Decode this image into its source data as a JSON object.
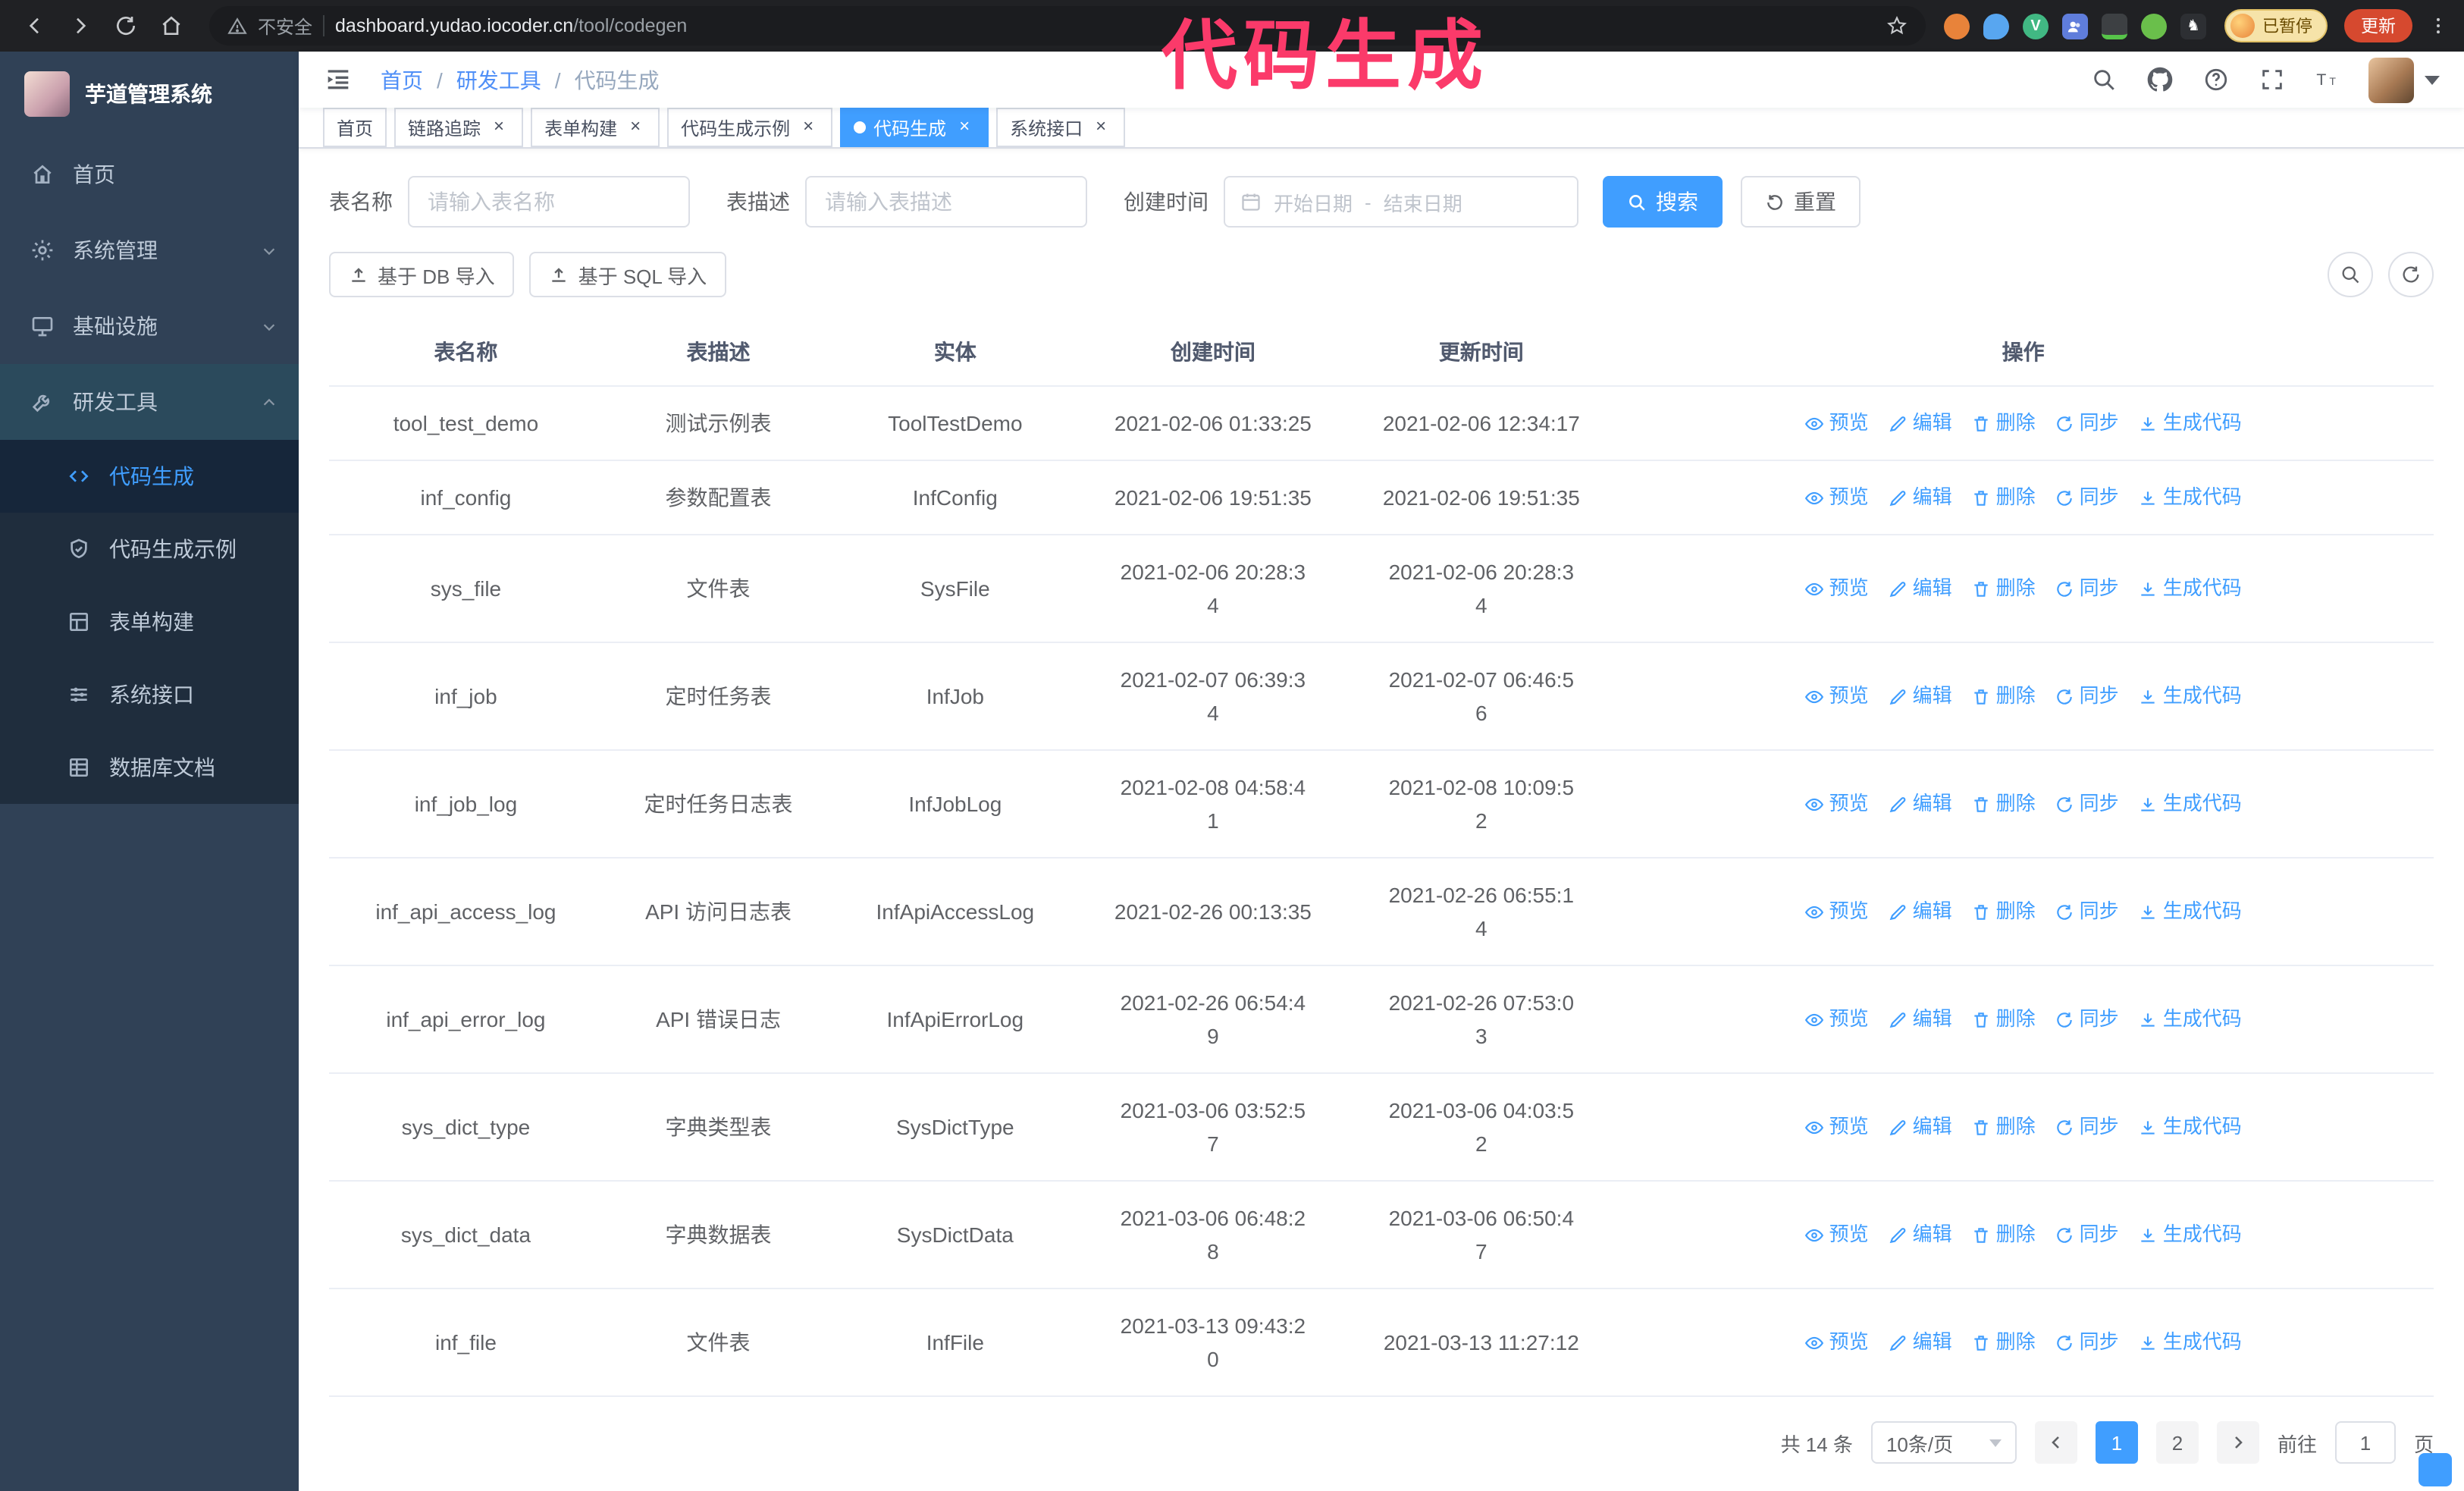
{
  "theme": {
    "accent": "#409eff",
    "annotation_color": "#fb3a6a",
    "sidebar_bg": "#304156",
    "submenu_bg": "#1f2d3d"
  },
  "browser": {
    "security_label": "不安全",
    "url_domain": "dashboard.yudao.iocoder.cn",
    "url_path": "/tool/codegen",
    "paused_badge": "已暂停",
    "update_button": "更新"
  },
  "annotation": {
    "text": "代码生成"
  },
  "sidebar": {
    "logo_title": "芋道管理系统",
    "items": [
      {
        "label": "首页",
        "icon": "home-icon"
      },
      {
        "label": "系统管理",
        "icon": "gear-icon"
      },
      {
        "label": "基础设施",
        "icon": "monitor-icon"
      },
      {
        "label": "研发工具",
        "icon": "wrench-icon",
        "children": [
          {
            "label": "代码生成",
            "icon": "code-icon",
            "active": true
          },
          {
            "label": "代码生成示例",
            "icon": "shield-icon"
          },
          {
            "label": "表单构建",
            "icon": "form-icon"
          },
          {
            "label": "系统接口",
            "icon": "sliders-icon"
          },
          {
            "label": "数据库文档",
            "icon": "table-grid-icon"
          }
        ]
      }
    ]
  },
  "breadcrumb": [
    "首页",
    "研发工具",
    "代码生成"
  ],
  "tabs": [
    {
      "label": "首页",
      "closable": false
    },
    {
      "label": "链路追踪",
      "closable": true
    },
    {
      "label": "表单构建",
      "closable": true
    },
    {
      "label": "代码生成示例",
      "closable": true
    },
    {
      "label": "代码生成",
      "closable": true,
      "active": true
    },
    {
      "label": "系统接口",
      "closable": true
    }
  ],
  "filters": {
    "table_name_label": "表名称",
    "table_name_placeholder": "请输入表名称",
    "table_desc_label": "表描述",
    "table_desc_placeholder": "请输入表描述",
    "create_time_label": "创建时间",
    "date_start_placeholder": "开始日期",
    "date_separator": "-",
    "date_end_placeholder": "结束日期",
    "search_button": "搜索",
    "reset_button": "重置"
  },
  "toolbar": {
    "import_db_button": "基于 DB 导入",
    "import_sql_button": "基于 SQL 导入"
  },
  "table": {
    "columns": [
      "表名称",
      "表描述",
      "实体",
      "创建时间",
      "更新时间",
      "操作"
    ],
    "actions": [
      "预览",
      "编辑",
      "删除",
      "同步",
      "生成代码"
    ],
    "rows": [
      {
        "name": "tool_test_demo",
        "desc": "测试示例表",
        "entity": "ToolTestDemo",
        "create_time": "2021-02-06 01:33:25",
        "update_time": "2021-02-06 12:34:17"
      },
      {
        "name": "inf_config",
        "desc": "参数配置表",
        "entity": "InfConfig",
        "create_time": "2021-02-06 19:51:35",
        "update_time": "2021-02-06 19:51:35"
      },
      {
        "name": "sys_file",
        "desc": "文件表",
        "entity": "SysFile",
        "create_time": "2021-02-06 20:28:3\n4",
        "update_time": "2021-02-06 20:28:3\n4"
      },
      {
        "name": "inf_job",
        "desc": "定时任务表",
        "entity": "InfJob",
        "create_time": "2021-02-07 06:39:3\n4",
        "update_time": "2021-02-07 06:46:5\n6"
      },
      {
        "name": "inf_job_log",
        "desc": "定时任务日志表",
        "entity": "InfJobLog",
        "create_time": "2021-02-08 04:58:4\n1",
        "update_time": "2021-02-08 10:09:5\n2"
      },
      {
        "name": "inf_api_access_log",
        "desc": "API 访问日志表",
        "entity": "InfApiAccessLog",
        "create_time": "2021-02-26 00:13:35",
        "update_time": "2021-02-26 06:55:1\n4"
      },
      {
        "name": "inf_api_error_log",
        "desc": "API 错误日志",
        "entity": "InfApiErrorLog",
        "create_time": "2021-02-26 06:54:4\n9",
        "update_time": "2021-02-26 07:53:0\n3"
      },
      {
        "name": "sys_dict_type",
        "desc": "字典类型表",
        "entity": "SysDictType",
        "create_time": "2021-03-06 03:52:5\n7",
        "update_time": "2021-03-06 04:03:5\n2"
      },
      {
        "name": "sys_dict_data",
        "desc": "字典数据表",
        "entity": "SysDictData",
        "create_time": "2021-03-06 06:48:2\n8",
        "update_time": "2021-03-06 06:50:4\n7"
      },
      {
        "name": "inf_file",
        "desc": "文件表",
        "entity": "InfFile",
        "create_time": "2021-03-13 09:43:2\n0",
        "update_time": "2021-03-13 11:27:12"
      }
    ]
  },
  "pagination": {
    "total_text": "共 14 条",
    "page_size": "10条/页",
    "pages": [
      "1",
      "2"
    ],
    "active_page": "1",
    "goto_label": "前往",
    "goto_value": "1",
    "page_suffix": "页"
  }
}
